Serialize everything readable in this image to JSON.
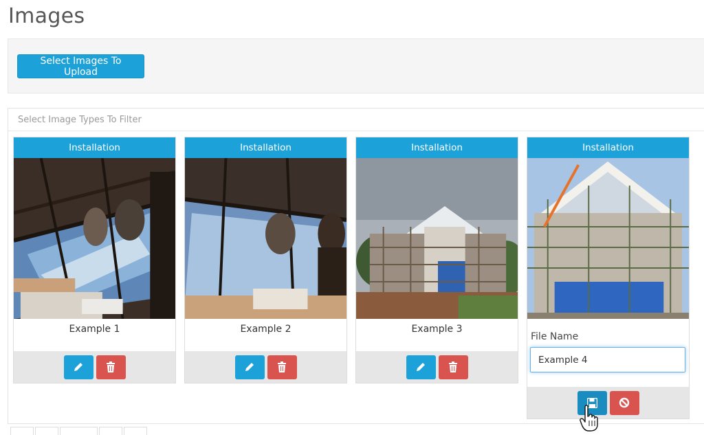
{
  "page": {
    "title": "Images"
  },
  "upload": {
    "button_label": "Select Images To Upload"
  },
  "filter": {
    "placeholder": "Select Image Types To Filter",
    "value": ""
  },
  "cards": [
    {
      "type": "Installation",
      "name": "Example 1"
    },
    {
      "type": "Installation",
      "name": "Example 2"
    },
    {
      "type": "Installation",
      "name": "Example 3"
    },
    {
      "type": "Installation",
      "name": "",
      "editing": true,
      "edit_label": "File Name",
      "edit_value": "Example 4"
    }
  ],
  "colors": {
    "accent": "#1da1d9",
    "danger": "#d9534f",
    "panel": "#f5f5f5",
    "footer": "#e6e6e6"
  },
  "icons": [
    "pencil-icon",
    "trash-icon",
    "floppy-disk-icon",
    "ban-icon",
    "hand-pointer-cursor"
  ]
}
